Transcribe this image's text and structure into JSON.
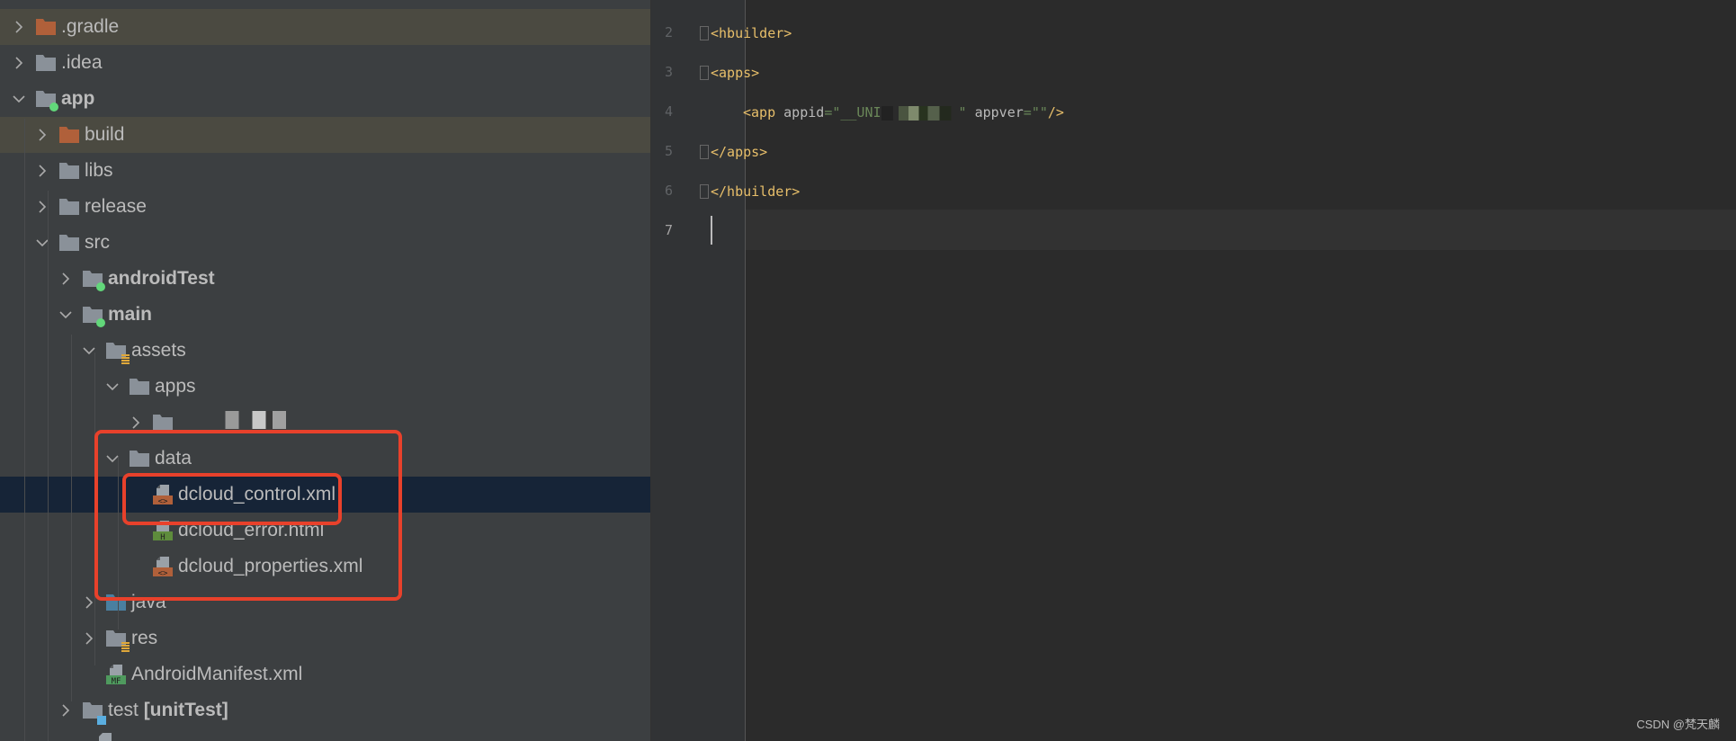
{
  "tree": {
    "items": [
      {
        "label": ".gradle",
        "level": 0,
        "expanded": false,
        "icon": "folder-orange-icon",
        "style": "ignored"
      },
      {
        "label": ".idea",
        "level": 0,
        "expanded": false,
        "icon": "folder-icon"
      },
      {
        "label": "app",
        "level": 0,
        "expanded": true,
        "icon": "module-folder-icon",
        "bold": true
      },
      {
        "label": "build",
        "level": 1,
        "expanded": false,
        "icon": "folder-orange-icon",
        "style": "ignored"
      },
      {
        "label": "libs",
        "level": 1,
        "expanded": false,
        "icon": "folder-icon"
      },
      {
        "label": "release",
        "level": 1,
        "expanded": false,
        "icon": "folder-icon"
      },
      {
        "label": "src",
        "level": 1,
        "expanded": true,
        "icon": "folder-icon"
      },
      {
        "label": "androidTest",
        "level": 2,
        "expanded": false,
        "icon": "module-folder-icon",
        "bold": true
      },
      {
        "label": "main",
        "level": 2,
        "expanded": true,
        "icon": "module-folder-icon",
        "bold": true
      },
      {
        "label": "assets",
        "level": 3,
        "expanded": true,
        "icon": "resource-folder-icon"
      },
      {
        "label": "apps",
        "level": 4,
        "expanded": true,
        "icon": "folder-icon"
      },
      {
        "label": "",
        "level": 5,
        "expanded": false,
        "icon": "folder-icon",
        "blurred": true
      },
      {
        "label": "data",
        "level": 4,
        "expanded": true,
        "icon": "folder-icon"
      },
      {
        "label": "dcloud_control.xml",
        "level": 5,
        "icon": "xml-file-icon",
        "style": "selected"
      },
      {
        "label": "dcloud_error.html",
        "level": 5,
        "icon": "html-file-icon"
      },
      {
        "label": "dcloud_properties.xml",
        "level": 5,
        "icon": "xml-file-icon"
      },
      {
        "label": "java",
        "level": 3,
        "expanded": false,
        "icon": "source-folder-icon"
      },
      {
        "label": "res",
        "level": 3,
        "expanded": false,
        "icon": "resource-folder-icon"
      },
      {
        "label": "AndroidManifest.xml",
        "level": 3,
        "icon": "manifest-file-icon"
      },
      {
        "label": "test [unitTest]",
        "level": 2,
        "expanded": false,
        "icon": "test-folder-icon",
        "bold_part": "[unitTest]"
      }
    ]
  },
  "editor": {
    "lines": [
      {
        "num": "2",
        "text": "<hbuilder>"
      },
      {
        "num": "3",
        "text": "<apps>"
      },
      {
        "num": "4",
        "tag": "<app ",
        "attr1": "appid",
        "eq1": "=",
        "val1": "\"__UNI",
        "val1_end": "\" ",
        "attr2": "appver",
        "eq2": "=",
        "val2": "\"\"",
        "close": "/>"
      },
      {
        "num": "5",
        "text": "</apps>"
      },
      {
        "num": "6",
        "text": "</hbuilder>"
      },
      {
        "num": "7",
        "text": ""
      }
    ]
  },
  "watermark": "CSDN @梵天麟",
  "colors": {
    "selection": "#162437",
    "highlight_box": "#e8412b",
    "xml_tag": "#e8bf6a",
    "string": "#6a8759"
  }
}
